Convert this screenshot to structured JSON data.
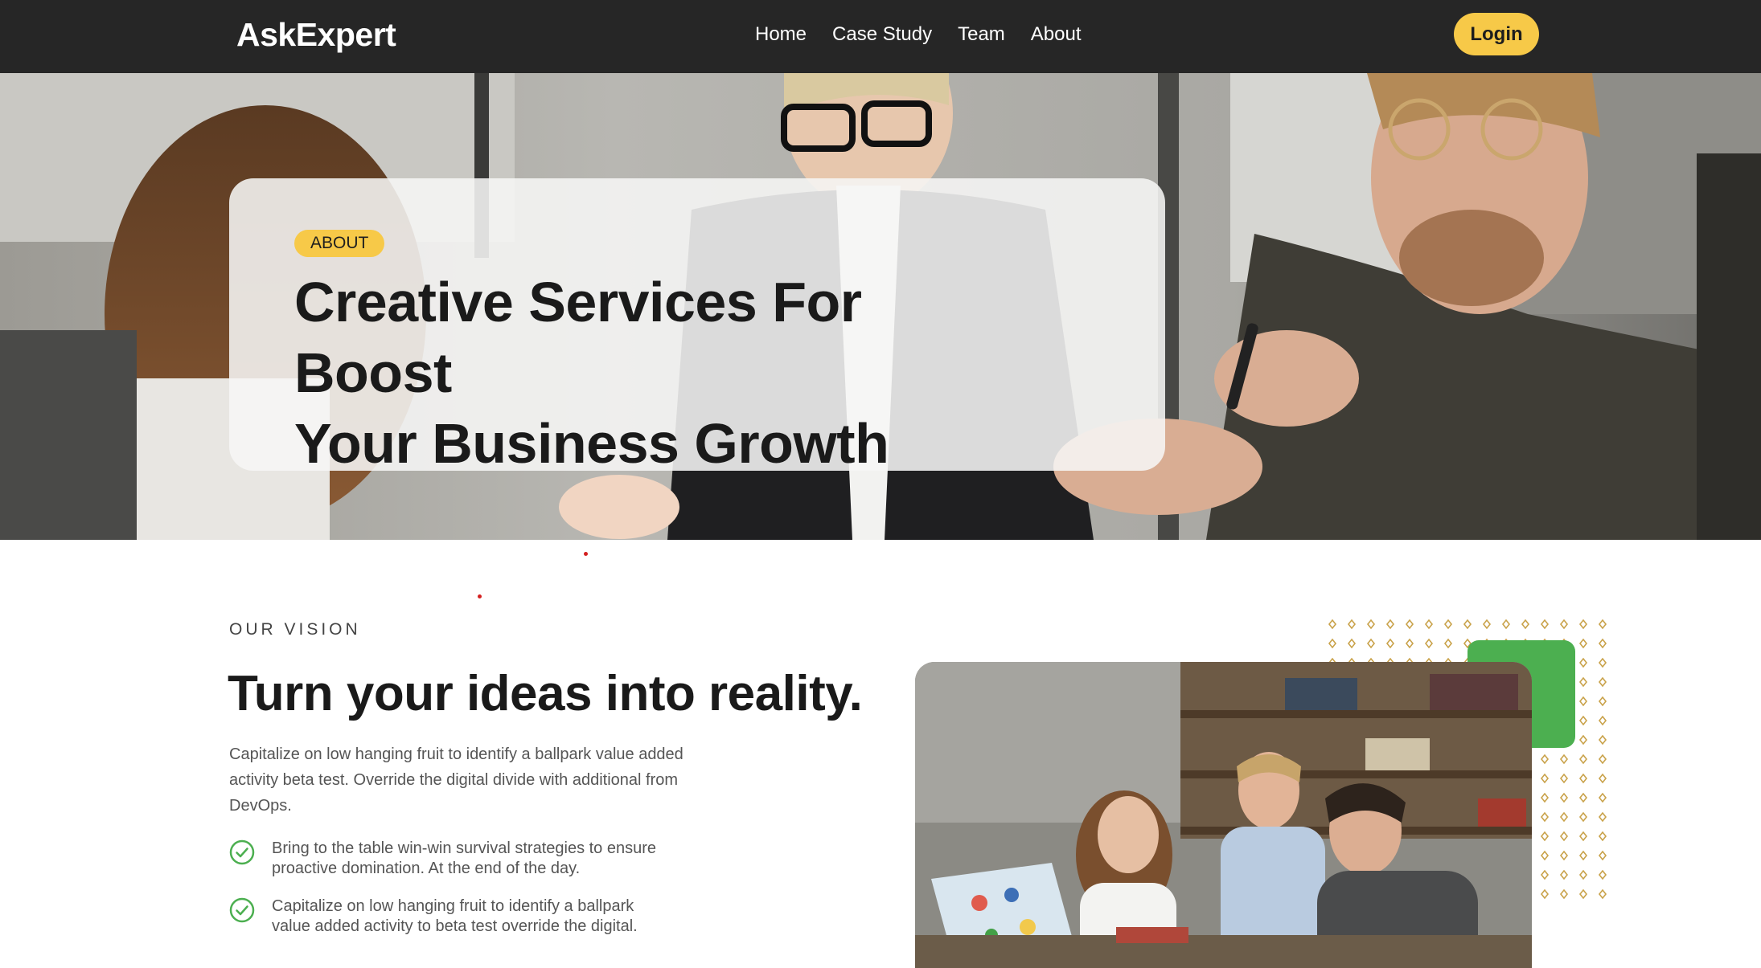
{
  "nav": {
    "brand": "AskExpert",
    "links": [
      "Home",
      "Case Study",
      "Team",
      "About"
    ],
    "login_label": "Login"
  },
  "hero": {
    "badge": "ABOUT",
    "title_line1": "Creative Services For Boost",
    "title_line2": "Your Business Growth"
  },
  "vision": {
    "eyebrow": "OUR VISION",
    "title": "Turn your ideas into reality.",
    "description": "Capitalize on low hanging fruit to identify a ballpark value added activity beta test. Override the digital divide with additional from DevOps.",
    "bullets": [
      "Bring to the table win-win survival strategies to ensure proactive domination. At the end of the day.",
      "Capitalize on low hanging fruit to identify a ballpark value added activity to beta test override the digital."
    ]
  },
  "colors": {
    "nav_bg": "#262626",
    "accent_yellow": "#f7c948",
    "accent_green": "#4caf50",
    "check_green": "#4caf50"
  }
}
